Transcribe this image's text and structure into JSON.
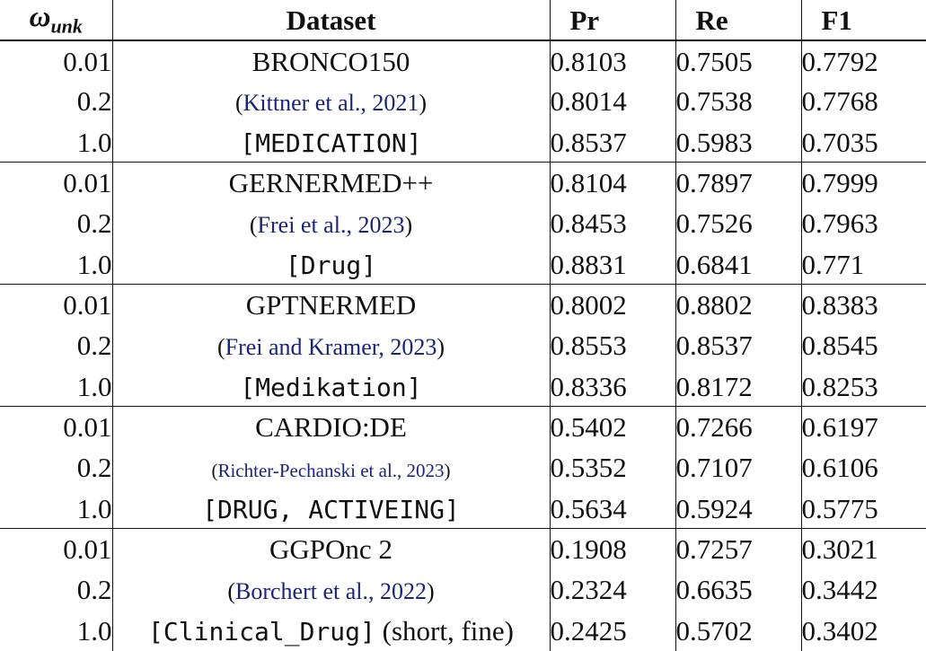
{
  "header": {
    "omega_symbol": "ω",
    "omega_subscript": "unk",
    "dataset": "Dataset",
    "pr": "Pr",
    "re": "Re",
    "f1": "F1"
  },
  "groups": [
    {
      "name": "BRONCO150",
      "citation": "Kittner et al., 2021",
      "label": "[MEDICATION]",
      "label_suffix": "",
      "rows": [
        {
          "w": "0.01",
          "pr": "0.8103",
          "re": "0.7505",
          "f1": "0.7792"
        },
        {
          "w": "0.2",
          "pr": "0.8014",
          "re": "0.7538",
          "f1": "0.7768"
        },
        {
          "w": "1.0",
          "pr": "0.8537",
          "re": "0.5983",
          "f1": "0.7035"
        }
      ]
    },
    {
      "name": "GERNERMED++",
      "citation": "Frei et al., 2023",
      "label": "[Drug]",
      "label_suffix": "",
      "rows": [
        {
          "w": "0.01",
          "pr": "0.8104",
          "re": "0.7897",
          "f1": "0.7999"
        },
        {
          "w": "0.2",
          "pr": "0.8453",
          "re": "0.7526",
          "f1": "0.7963"
        },
        {
          "w": "1.0",
          "pr": "0.8831",
          "re": "0.6841",
          "f1": "0.771"
        }
      ]
    },
    {
      "name": "GPTNERMED",
      "citation": "Frei and Kramer, 2023",
      "label": "[Medikation]",
      "label_suffix": "",
      "rows": [
        {
          "w": "0.01",
          "pr": "0.8002",
          "re": "0.8802",
          "f1": "0.8383"
        },
        {
          "w": "0.2",
          "pr": "0.8553",
          "re": "0.8537",
          "f1": "0.8545"
        },
        {
          "w": "1.0",
          "pr": "0.8336",
          "re": "0.8172",
          "f1": "0.8253"
        }
      ]
    },
    {
      "name": "CARDIO:DE",
      "citation": "Richter-Pechanski et al., 2023",
      "label": "[DRUG, ACTIVEING]",
      "label_suffix": "",
      "rows": [
        {
          "w": "0.01",
          "pr": "0.5402",
          "re": "0.7266",
          "f1": "0.6197"
        },
        {
          "w": "0.2",
          "pr": "0.5352",
          "re": "0.7107",
          "f1": "0.6106"
        },
        {
          "w": "1.0",
          "pr": "0.5634",
          "re": "0.5924",
          "f1": "0.5775"
        }
      ]
    },
    {
      "name": "GGPOnc 2",
      "citation": "Borchert et al., 2022",
      "label": "[Clinical_Drug]",
      "label_suffix": " (short, fine)",
      "rows": [
        {
          "w": "0.01",
          "pr": "0.1908",
          "re": "0.7257",
          "f1": "0.3021"
        },
        {
          "w": "0.2",
          "pr": "0.2324",
          "re": "0.6635",
          "f1": "0.3442"
        },
        {
          "w": "1.0",
          "pr": "0.2425",
          "re": "0.5702",
          "f1": "0.3402"
        }
      ]
    }
  ]
}
